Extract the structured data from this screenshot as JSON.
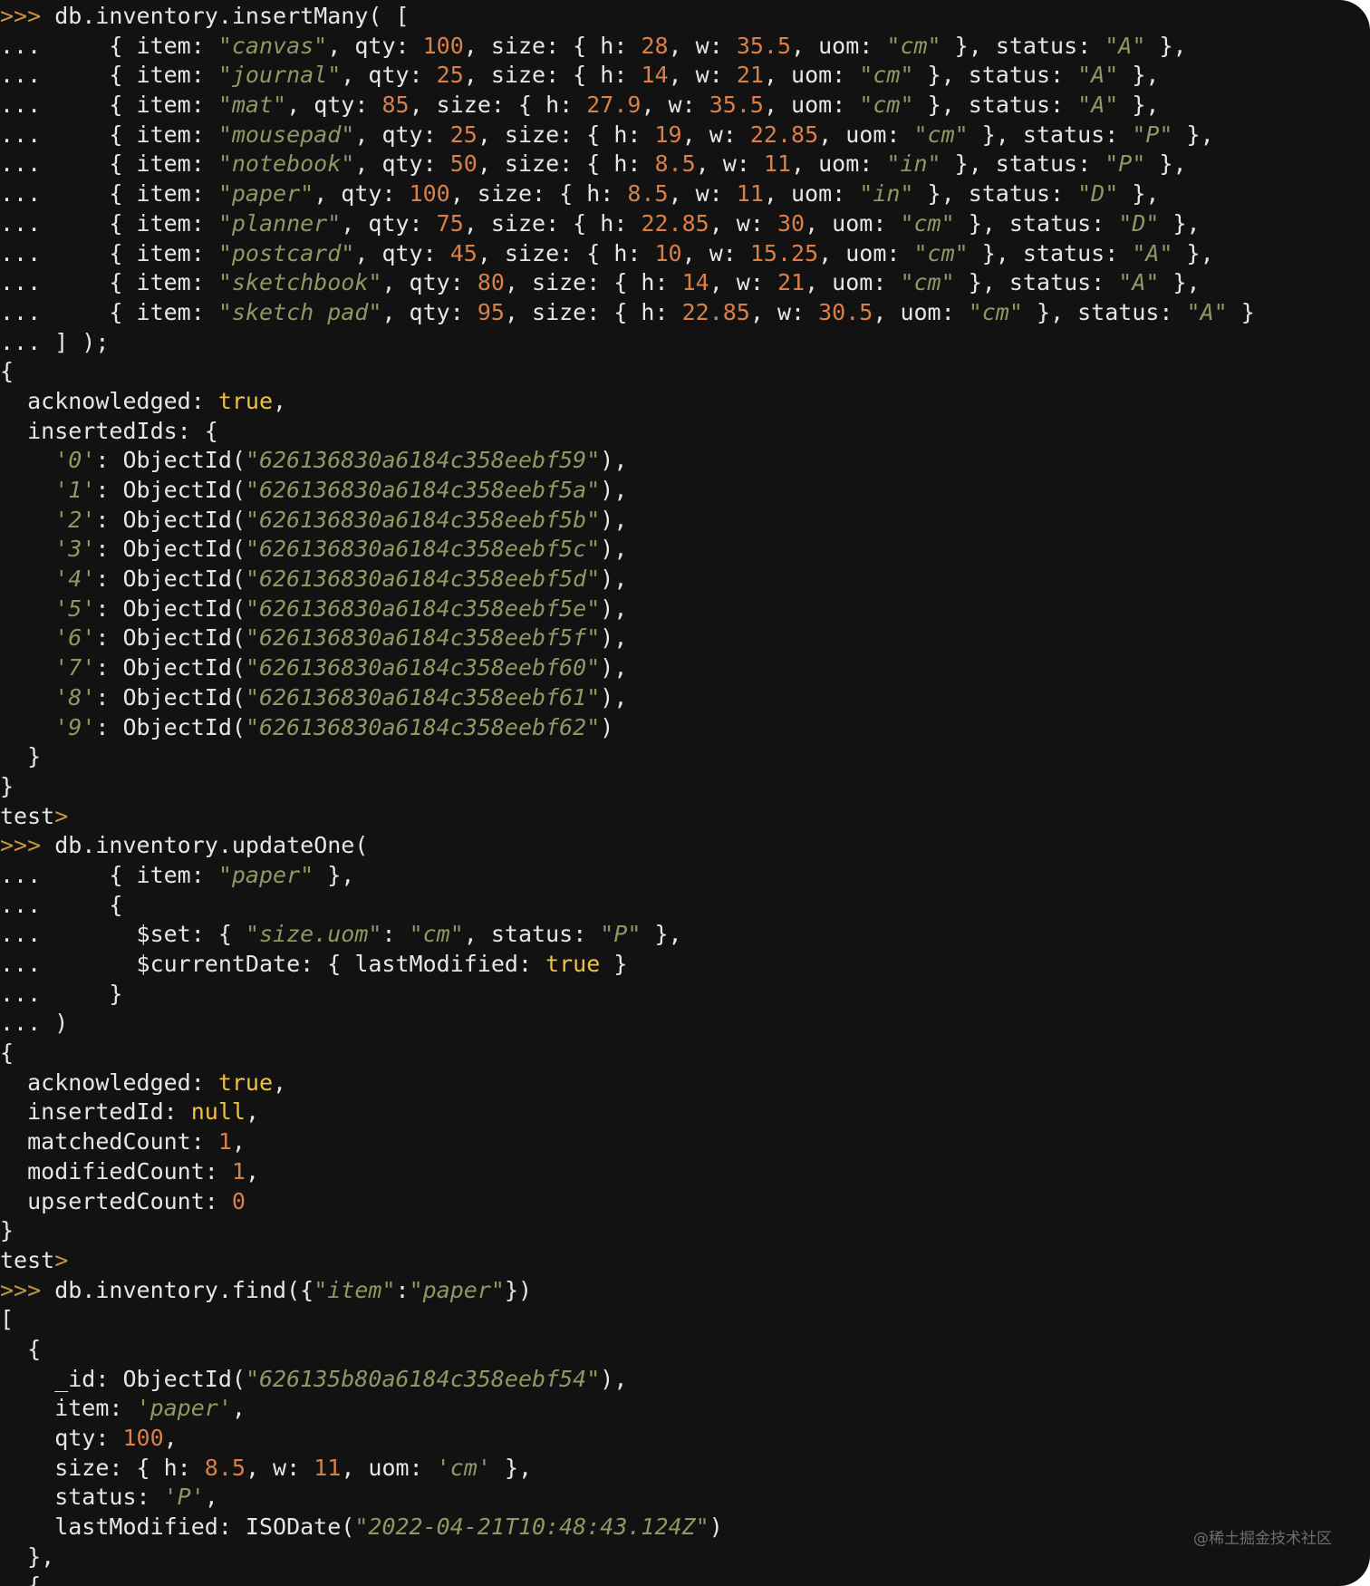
{
  "theme": {
    "background": "#121212",
    "text": "#e6e6e6",
    "string": "#8d9962",
    "number": "#d97f48",
    "boolean": "#f0c043",
    "prompt": "#c8963e"
  },
  "watermark": "@稀土掘金技术社区",
  "terminal_lines": [
    [
      [
        "p",
        ">>> "
      ],
      [
        "x",
        "db.inventory.insertMany( ["
      ]
    ],
    [
      [
        "x",
        "...     { item: "
      ],
      [
        "s",
        "\"canvas\""
      ],
      [
        "x",
        ", qty: "
      ],
      [
        "n",
        "100"
      ],
      [
        "x",
        ", size: { h: "
      ],
      [
        "n",
        "28"
      ],
      [
        "x",
        ", w: "
      ],
      [
        "n",
        "35.5"
      ],
      [
        "x",
        ", uom: "
      ],
      [
        "s",
        "\"cm\""
      ],
      [
        "x",
        " }, status: "
      ],
      [
        "s",
        "\"A\""
      ],
      [
        "x",
        " },"
      ]
    ],
    [
      [
        "x",
        "...     { item: "
      ],
      [
        "s",
        "\"journal\""
      ],
      [
        "x",
        ", qty: "
      ],
      [
        "n",
        "25"
      ],
      [
        "x",
        ", size: { h: "
      ],
      [
        "n",
        "14"
      ],
      [
        "x",
        ", w: "
      ],
      [
        "n",
        "21"
      ],
      [
        "x",
        ", uom: "
      ],
      [
        "s",
        "\"cm\""
      ],
      [
        "x",
        " }, status: "
      ],
      [
        "s",
        "\"A\""
      ],
      [
        "x",
        " },"
      ]
    ],
    [
      [
        "x",
        "...     { item: "
      ],
      [
        "s",
        "\"mat\""
      ],
      [
        "x",
        ", qty: "
      ],
      [
        "n",
        "85"
      ],
      [
        "x",
        ", size: { h: "
      ],
      [
        "n",
        "27.9"
      ],
      [
        "x",
        ", w: "
      ],
      [
        "n",
        "35.5"
      ],
      [
        "x",
        ", uom: "
      ],
      [
        "s",
        "\"cm\""
      ],
      [
        "x",
        " }, status: "
      ],
      [
        "s",
        "\"A\""
      ],
      [
        "x",
        " },"
      ]
    ],
    [
      [
        "x",
        "...     { item: "
      ],
      [
        "s",
        "\"mousepad\""
      ],
      [
        "x",
        ", qty: "
      ],
      [
        "n",
        "25"
      ],
      [
        "x",
        ", size: { h: "
      ],
      [
        "n",
        "19"
      ],
      [
        "x",
        ", w: "
      ],
      [
        "n",
        "22.85"
      ],
      [
        "x",
        ", uom: "
      ],
      [
        "s",
        "\"cm\""
      ],
      [
        "x",
        " }, status: "
      ],
      [
        "s",
        "\"P\""
      ],
      [
        "x",
        " },"
      ]
    ],
    [
      [
        "x",
        "...     { item: "
      ],
      [
        "s",
        "\"notebook\""
      ],
      [
        "x",
        ", qty: "
      ],
      [
        "n",
        "50"
      ],
      [
        "x",
        ", size: { h: "
      ],
      [
        "n",
        "8.5"
      ],
      [
        "x",
        ", w: "
      ],
      [
        "n",
        "11"
      ],
      [
        "x",
        ", uom: "
      ],
      [
        "s",
        "\"in\""
      ],
      [
        "x",
        " }, status: "
      ],
      [
        "s",
        "\"P\""
      ],
      [
        "x",
        " },"
      ]
    ],
    [
      [
        "x",
        "...     { item: "
      ],
      [
        "s",
        "\"paper\""
      ],
      [
        "x",
        ", qty: "
      ],
      [
        "n",
        "100"
      ],
      [
        "x",
        ", size: { h: "
      ],
      [
        "n",
        "8.5"
      ],
      [
        "x",
        ", w: "
      ],
      [
        "n",
        "11"
      ],
      [
        "x",
        ", uom: "
      ],
      [
        "s",
        "\"in\""
      ],
      [
        "x",
        " }, status: "
      ],
      [
        "s",
        "\"D\""
      ],
      [
        "x",
        " },"
      ]
    ],
    [
      [
        "x",
        "...     { item: "
      ],
      [
        "s",
        "\"planner\""
      ],
      [
        "x",
        ", qty: "
      ],
      [
        "n",
        "75"
      ],
      [
        "x",
        ", size: { h: "
      ],
      [
        "n",
        "22.85"
      ],
      [
        "x",
        ", w: "
      ],
      [
        "n",
        "30"
      ],
      [
        "x",
        ", uom: "
      ],
      [
        "s",
        "\"cm\""
      ],
      [
        "x",
        " }, status: "
      ],
      [
        "s",
        "\"D\""
      ],
      [
        "x",
        " },"
      ]
    ],
    [
      [
        "x",
        "...     { item: "
      ],
      [
        "s",
        "\"postcard\""
      ],
      [
        "x",
        ", qty: "
      ],
      [
        "n",
        "45"
      ],
      [
        "x",
        ", size: { h: "
      ],
      [
        "n",
        "10"
      ],
      [
        "x",
        ", w: "
      ],
      [
        "n",
        "15.25"
      ],
      [
        "x",
        ", uom: "
      ],
      [
        "s",
        "\"cm\""
      ],
      [
        "x",
        " }, status: "
      ],
      [
        "s",
        "\"A\""
      ],
      [
        "x",
        " },"
      ]
    ],
    [
      [
        "x",
        "...     { item: "
      ],
      [
        "s",
        "\"sketchbook\""
      ],
      [
        "x",
        ", qty: "
      ],
      [
        "n",
        "80"
      ],
      [
        "x",
        ", size: { h: "
      ],
      [
        "n",
        "14"
      ],
      [
        "x",
        ", w: "
      ],
      [
        "n",
        "21"
      ],
      [
        "x",
        ", uom: "
      ],
      [
        "s",
        "\"cm\""
      ],
      [
        "x",
        " }, status: "
      ],
      [
        "s",
        "\"A\""
      ],
      [
        "x",
        " },"
      ]
    ],
    [
      [
        "x",
        "...     { item: "
      ],
      [
        "s",
        "\"sketch pad\""
      ],
      [
        "x",
        ", qty: "
      ],
      [
        "n",
        "95"
      ],
      [
        "x",
        ", size: { h: "
      ],
      [
        "n",
        "22.85"
      ],
      [
        "x",
        ", w: "
      ],
      [
        "n",
        "30.5"
      ],
      [
        "x",
        ", uom: "
      ],
      [
        "s",
        "\"cm\""
      ],
      [
        "x",
        " }, status: "
      ],
      [
        "s",
        "\"A\""
      ],
      [
        "x",
        " }"
      ]
    ],
    [
      [
        "x",
        "... ] );"
      ]
    ],
    [
      [
        "x",
        "{"
      ]
    ],
    [
      [
        "x",
        "  acknowledged: "
      ],
      [
        "b",
        "true"
      ],
      [
        "x",
        ","
      ]
    ],
    [
      [
        "x",
        "  insertedIds: {"
      ]
    ],
    [
      [
        "x",
        "    "
      ],
      [
        "s",
        "'0'"
      ],
      [
        "x",
        ": ObjectId("
      ],
      [
        "s",
        "\"626136830a6184c358eebf59\""
      ],
      [
        "x",
        "),"
      ]
    ],
    [
      [
        "x",
        "    "
      ],
      [
        "s",
        "'1'"
      ],
      [
        "x",
        ": ObjectId("
      ],
      [
        "s",
        "\"626136830a6184c358eebf5a\""
      ],
      [
        "x",
        "),"
      ]
    ],
    [
      [
        "x",
        "    "
      ],
      [
        "s",
        "'2'"
      ],
      [
        "x",
        ": ObjectId("
      ],
      [
        "s",
        "\"626136830a6184c358eebf5b\""
      ],
      [
        "x",
        "),"
      ]
    ],
    [
      [
        "x",
        "    "
      ],
      [
        "s",
        "'3'"
      ],
      [
        "x",
        ": ObjectId("
      ],
      [
        "s",
        "\"626136830a6184c358eebf5c\""
      ],
      [
        "x",
        "),"
      ]
    ],
    [
      [
        "x",
        "    "
      ],
      [
        "s",
        "'4'"
      ],
      [
        "x",
        ": ObjectId("
      ],
      [
        "s",
        "\"626136830a6184c358eebf5d\""
      ],
      [
        "x",
        "),"
      ]
    ],
    [
      [
        "x",
        "    "
      ],
      [
        "s",
        "'5'"
      ],
      [
        "x",
        ": ObjectId("
      ],
      [
        "s",
        "\"626136830a6184c358eebf5e\""
      ],
      [
        "x",
        "),"
      ]
    ],
    [
      [
        "x",
        "    "
      ],
      [
        "s",
        "'6'"
      ],
      [
        "x",
        ": ObjectId("
      ],
      [
        "s",
        "\"626136830a6184c358eebf5f\""
      ],
      [
        "x",
        "),"
      ]
    ],
    [
      [
        "x",
        "    "
      ],
      [
        "s",
        "'7'"
      ],
      [
        "x",
        ": ObjectId("
      ],
      [
        "s",
        "\"626136830a6184c358eebf60\""
      ],
      [
        "x",
        "),"
      ]
    ],
    [
      [
        "x",
        "    "
      ],
      [
        "s",
        "'8'"
      ],
      [
        "x",
        ": ObjectId("
      ],
      [
        "s",
        "\"626136830a6184c358eebf61\""
      ],
      [
        "x",
        "),"
      ]
    ],
    [
      [
        "x",
        "    "
      ],
      [
        "s",
        "'9'"
      ],
      [
        "x",
        ": ObjectId("
      ],
      [
        "s",
        "\"626136830a6184c358eebf62\""
      ],
      [
        "x",
        ")"
      ]
    ],
    [
      [
        "x",
        "  }"
      ]
    ],
    [
      [
        "x",
        "}"
      ]
    ],
    [
      [
        "x",
        "test"
      ],
      [
        "p",
        ">"
      ]
    ],
    [
      [
        "p",
        ">>> "
      ],
      [
        "x",
        "db.inventory.updateOne("
      ]
    ],
    [
      [
        "x",
        "...     { item: "
      ],
      [
        "s",
        "\"paper\""
      ],
      [
        "x",
        " },"
      ]
    ],
    [
      [
        "x",
        "...     {"
      ]
    ],
    [
      [
        "x",
        "...       $set: { "
      ],
      [
        "s",
        "\"size.uom\""
      ],
      [
        "x",
        ": "
      ],
      [
        "s",
        "\"cm\""
      ],
      [
        "x",
        ", status: "
      ],
      [
        "s",
        "\"P\""
      ],
      [
        "x",
        " },"
      ]
    ],
    [
      [
        "x",
        "...       $currentDate: { lastModified: "
      ],
      [
        "b",
        "true"
      ],
      [
        "x",
        " }"
      ]
    ],
    [
      [
        "x",
        "...     }"
      ]
    ],
    [
      [
        "x",
        "... )"
      ]
    ],
    [
      [
        "x",
        "{"
      ]
    ],
    [
      [
        "x",
        "  acknowledged: "
      ],
      [
        "b",
        "true"
      ],
      [
        "x",
        ","
      ]
    ],
    [
      [
        "x",
        "  insertedId: "
      ],
      [
        "b",
        "null"
      ],
      [
        "x",
        ","
      ]
    ],
    [
      [
        "x",
        "  matchedCount: "
      ],
      [
        "n",
        "1"
      ],
      [
        "x",
        ","
      ]
    ],
    [
      [
        "x",
        "  modifiedCount: "
      ],
      [
        "n",
        "1"
      ],
      [
        "x",
        ","
      ]
    ],
    [
      [
        "x",
        "  upsertedCount: "
      ],
      [
        "n",
        "0"
      ]
    ],
    [
      [
        "x",
        "}"
      ]
    ],
    [
      [
        "x",
        "test"
      ],
      [
        "p",
        ">"
      ]
    ],
    [
      [
        "p",
        ">>> "
      ],
      [
        "x",
        "db.inventory.find({"
      ],
      [
        "s",
        "\"item\""
      ],
      [
        "x",
        ":"
      ],
      [
        "s",
        "\"paper\""
      ],
      [
        "x",
        "})"
      ]
    ],
    [
      [
        "x",
        "["
      ]
    ],
    [
      [
        "x",
        "  {"
      ]
    ],
    [
      [
        "x",
        "    _id: ObjectId("
      ],
      [
        "s",
        "\"626135b80a6184c358eebf54\""
      ],
      [
        "x",
        "),"
      ]
    ],
    [
      [
        "x",
        "    item: "
      ],
      [
        "s",
        "'paper'"
      ],
      [
        "x",
        ","
      ]
    ],
    [
      [
        "x",
        "    qty: "
      ],
      [
        "n",
        "100"
      ],
      [
        "x",
        ","
      ]
    ],
    [
      [
        "x",
        "    size: { h: "
      ],
      [
        "n",
        "8.5"
      ],
      [
        "x",
        ", w: "
      ],
      [
        "n",
        "11"
      ],
      [
        "x",
        ", uom: "
      ],
      [
        "s",
        "'cm'"
      ],
      [
        "x",
        " },"
      ]
    ],
    [
      [
        "x",
        "    status: "
      ],
      [
        "s",
        "'P'"
      ],
      [
        "x",
        ","
      ]
    ],
    [
      [
        "x",
        "    lastModified: ISODate("
      ],
      [
        "s",
        "\"2022-04-21T10:48:43.124Z\""
      ],
      [
        "x",
        ")"
      ]
    ],
    [
      [
        "x",
        "  },"
      ]
    ],
    [
      [
        "x",
        "  {"
      ]
    ]
  ]
}
